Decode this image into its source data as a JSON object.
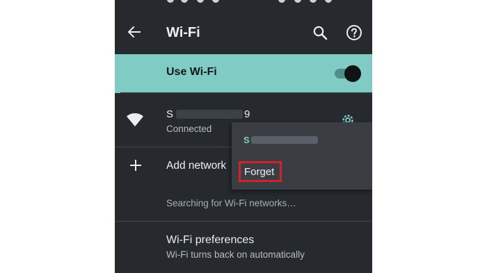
{
  "appbar": {
    "title": "Wi-Fi"
  },
  "use_wifi": {
    "label": "Use Wi-Fi",
    "enabled": true
  },
  "network": {
    "ssid_start": "S",
    "ssid_end": "9",
    "status": "Connected"
  },
  "add_network": {
    "label": "Add network"
  },
  "searching": {
    "text": "Searching for Wi-Fi networks…"
  },
  "preferences": {
    "title": "Wi-Fi preferences",
    "subtitle": "Wi-Fi turns back on automatically"
  },
  "popup_menu": {
    "ssid_start": "S",
    "items": [
      {
        "label": "Forget"
      }
    ]
  },
  "colors": {
    "background": "#262a2e",
    "accent": "#80cbc4",
    "highlight_border": "#d3222a"
  }
}
